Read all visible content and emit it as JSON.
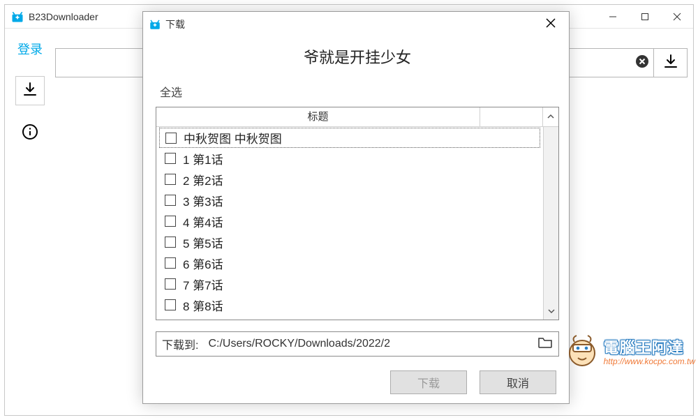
{
  "main": {
    "title": "B23Downloader",
    "login": "登录"
  },
  "dialog": {
    "title": "下载",
    "heading": "爷就是开挂少女",
    "select_all": "全选",
    "column_title": "标题",
    "items": [
      {
        "label": "中秋贺图 中秋贺图"
      },
      {
        "label": "1 第1话"
      },
      {
        "label": "2 第2话"
      },
      {
        "label": "3 第3话"
      },
      {
        "label": "4 第4话"
      },
      {
        "label": "5 第5话"
      },
      {
        "label": "6 第6话"
      },
      {
        "label": "7 第7话"
      },
      {
        "label": "8 第8话"
      }
    ],
    "path_label": "下载到:",
    "path_value": "C:/Users/ROCKY/Downloads/2022/2",
    "download_btn": "下载",
    "cancel_btn": "取消"
  },
  "watermark": {
    "text": "電腦王阿達",
    "url": "http://www.kocpc.com.tw"
  }
}
